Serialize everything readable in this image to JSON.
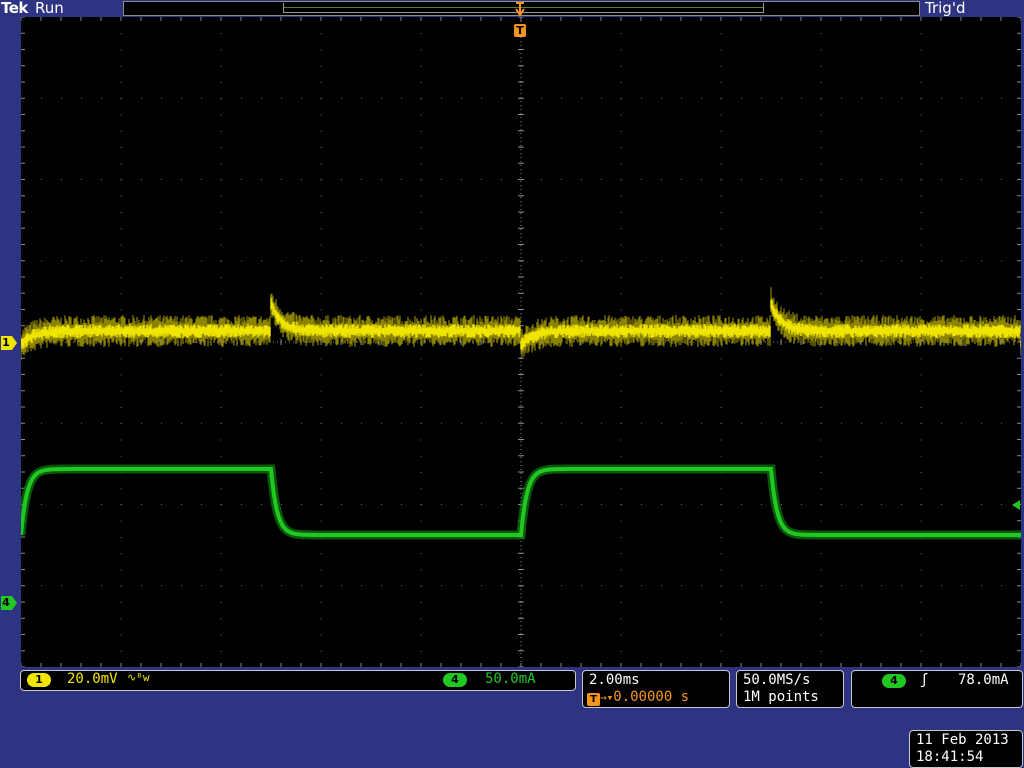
{
  "header": {
    "brand": "Tek",
    "run_status": "Run",
    "trigger_status": "Trig'd",
    "trigger_marker": "T"
  },
  "channels": {
    "ch1": {
      "label": "1",
      "scale": "20.0mV",
      "bandwidth_icon": "bandwidth-limit-icon",
      "color": "#f0e500"
    },
    "ch4": {
      "label": "4",
      "scale": "50.0mA",
      "color": "#22c822"
    }
  },
  "timebase": {
    "scale": "2.00ms",
    "position_marker": "T",
    "position": "0.00000 s"
  },
  "acquisition": {
    "sample_rate": "50.0MS/s",
    "record_length": "1M points"
  },
  "trigger": {
    "source": "4",
    "slope_icon": "rising-edge-icon",
    "level": "78.0mA",
    "color": "#f7941d"
  },
  "datetime": {
    "date": "11 Feb  2013",
    "time": "18:41:54"
  },
  "colors": {
    "background": "#2e3482",
    "graticule": "#000000",
    "grid": "#6b6b6b"
  }
}
